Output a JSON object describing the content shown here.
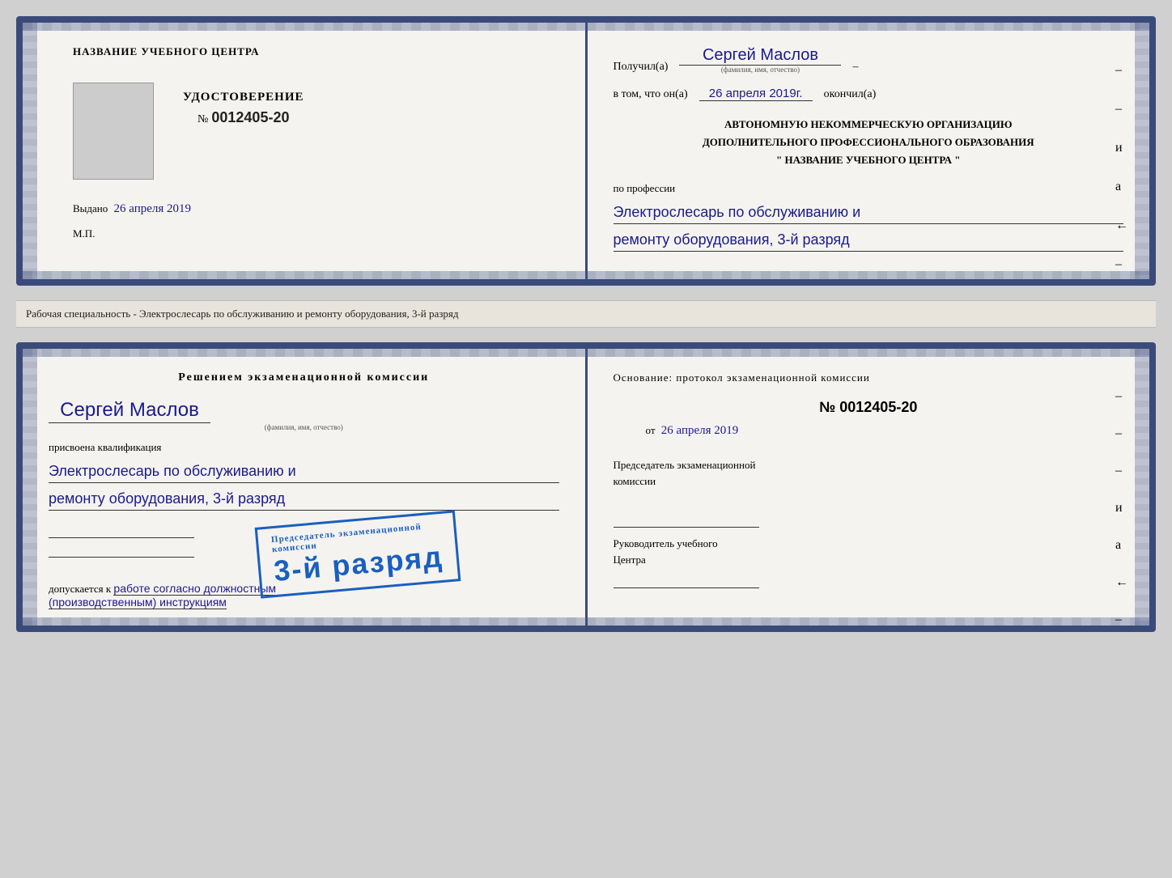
{
  "cert1": {
    "left": {
      "org_title": "НАЗВАНИЕ УЧЕБНОГО ЦЕНТРА",
      "udostoverenie_label": "УДОСТОВЕРЕНИЕ",
      "number_prefix": "№",
      "number": "0012405-20",
      "vydano_prefix": "Выдано",
      "vydano_date": "26 апреля 2019",
      "mp_label": "М.П."
    },
    "right": {
      "poluchil_prefix": "Получил(а)",
      "name": "Сергей Маслов",
      "name_sublabel": "(фамилия, имя, отчество)",
      "dash": "–",
      "vtom_prefix": "в том, что он(а)",
      "date_handwritten": "26 апреля 2019г.",
      "okonchil": "окончил(а)",
      "org_line1": "АВТОНОМНУЮ НЕКОММЕРЧЕСКУЮ ОРГАНИЗАЦИЮ",
      "org_line2": "ДОПОЛНИТЕЛЬНОГО ПРОФЕССИОНАЛЬНОГО ОБРАЗОВАНИЯ",
      "org_line3": "\"   НАЗВАНИЕ УЧЕБНОГО ЦЕНТРА   \"",
      "po_professii": "по профессии",
      "profession_line1": "Электрослесарь по обслуживанию и",
      "profession_line2": "ремонту оборудования, 3-й разряд"
    }
  },
  "middle_label": "Рабочая специальность - Электрослесарь по обслуживанию и ремонту оборудования, 3-й разряд",
  "cert2": {
    "left": {
      "resheniem_title": "Решением экзаменационной комиссии",
      "name": "Сергей Маслов",
      "name_sublabel": "(фамилия, имя, отчество)",
      "prisvoena": "присвоена квалификация",
      "profession_line1": "Электрослесарь по обслуживанию и",
      "profession_line2": "ремонту оборудования, 3-й разряд",
      "dopuskaetsya_prefix": "допускается к",
      "dopuskaetsya_handwritten": "работе согласно должностным",
      "dopuskaetsya_line2": "(производственным) инструкциям"
    },
    "stamp": {
      "line1": "Председатель экзаменационной",
      "line2": "комиссии",
      "big_text": "3-й разряд"
    },
    "right": {
      "osnovanie": "Основание: протокол экзаменационной комиссии",
      "number_prefix": "№",
      "number": "0012405-20",
      "ot_prefix": "от",
      "ot_date": "26 апреля 2019",
      "predsedatel_line1": "Председатель экзаменационной",
      "predsedatel_line2": "комиссии",
      "rukovoditel_line1": "Руководитель учебного",
      "rukovoditel_line2": "Центра",
      "dashes": [
        "-",
        "-",
        "-",
        "и",
        "а",
        "←",
        "-"
      ]
    }
  }
}
